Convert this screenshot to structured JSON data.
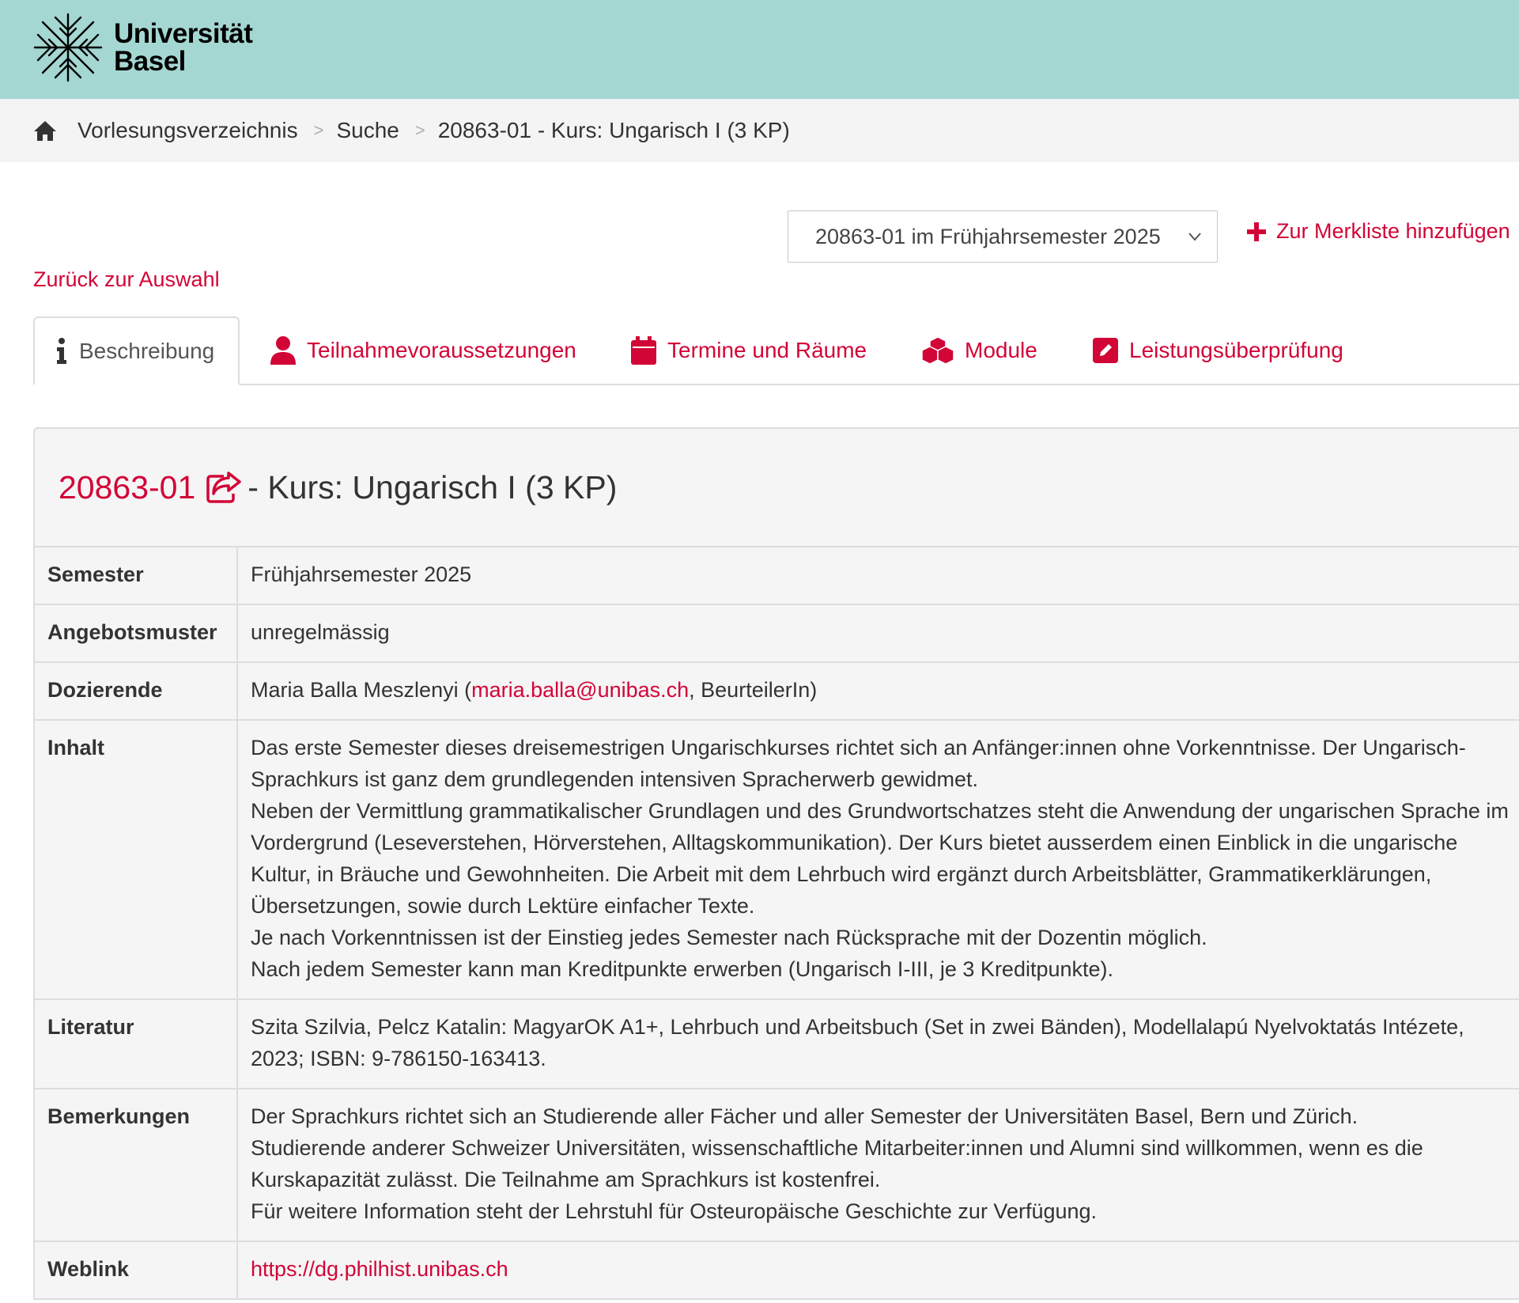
{
  "header": {
    "logo_line1": "Universität",
    "logo_line2": "Basel"
  },
  "breadcrumb": {
    "home_icon": "home-icon",
    "items": [
      "Vorlesungsverzeichnis",
      "Suche",
      "20863-01 - Kurs: Ungarisch I (3 KP)"
    ],
    "separator": ">"
  },
  "semester_select": {
    "value": "20863-01 im Frühjahrsemester 2025"
  },
  "merkliste": {
    "label": "Zur Merkliste hinzufügen"
  },
  "back_link": "Zurück zur Auswahl",
  "tabs": [
    {
      "label": "Beschreibung",
      "icon": "info-icon"
    },
    {
      "label": "Teilnahmevoraussetzungen",
      "icon": "user-icon"
    },
    {
      "label": "Termine und Räume",
      "icon": "calendar-icon"
    },
    {
      "label": "Module",
      "icon": "cubes-icon"
    },
    {
      "label": "Leistungsüberprüfung",
      "icon": "edit-icon"
    }
  ],
  "course": {
    "code": "20863-01",
    "title_rest": "- Kurs: Ungarisch I (3 KP)"
  },
  "details": {
    "semester": {
      "label": "Semester",
      "value": "Frühjahrsemester 2025"
    },
    "angebotsmuster": {
      "label": "Angebotsmuster",
      "value": "unregelmässig"
    },
    "dozierende": {
      "label": "Dozierende",
      "name": "Maria Balla Meszlenyi (",
      "email": "maria.balla@unibas.ch",
      "role": ", BeurteilerIn)"
    },
    "inhalt": {
      "label": "Inhalt",
      "paragraphs": [
        "Das erste Semester dieses dreisemestrigen Ungarischkurses richtet sich an Anfänger:innen ohne Vorkenntnisse. Der Ungarisch-Sprachkurs ist ganz dem grundlegenden intensiven Spracherwerb gewidmet.",
        "Neben der Vermittlung grammatikalischer Grundlagen und des Grundwortschatzes steht die Anwendung der ungarischen Sprache im Vordergrund (Leseverstehen, Hörverstehen, Alltagskommunikation). Der Kurs bietet ausserdem einen Einblick in die ungarische Kultur, in Bräuche und Gewohnheiten. Die Arbeit mit dem Lehrbuch wird ergänzt durch Arbeitsblätter, Grammatikerklärungen, Übersetzungen, sowie durch Lektüre einfacher Texte.",
        "Je nach Vorkenntnissen ist der Einstieg jedes Semester nach Rücksprache mit der Dozentin möglich.",
        "Nach jedem Semester kann man Kreditpunkte erwerben (Ungarisch I-III, je 3 Kreditpunkte)."
      ]
    },
    "literatur": {
      "label": "Literatur",
      "value": "Szita Szilvia, Pelcz Katalin: MagyarOK A1+, Lehrbuch und Arbeitsbuch (Set in zwei Bänden), Modellalapú Nyelvoktatás Intézete, 2023; ISBN: 9-786150-163413."
    },
    "bemerkungen": {
      "label": "Bemerkungen",
      "paragraphs": [
        "Der Sprachkurs richtet sich an Studierende aller Fächer und aller Semester der Universitäten Basel, Bern und Zürich.",
        "Studierende anderer Schweizer Universitäten, wissenschaftliche Mitarbeiter:innen und Alumni sind willkommen, wenn es die Kurskapazität zulässt. Die Teilnahme am Sprachkurs ist kostenfrei.",
        "Für weitere Information steht der Lehrstuhl für Osteuropäische Geschichte zur Verfügung."
      ]
    },
    "weblink": {
      "label": "Weblink",
      "value": "https://dg.philhist.unibas.ch"
    }
  },
  "colors": {
    "header_bg": "#a5d7d2",
    "accent": "#d20537",
    "breadcrumb_bg": "#f4f4f4",
    "panel_bg": "#f5f5f5"
  }
}
